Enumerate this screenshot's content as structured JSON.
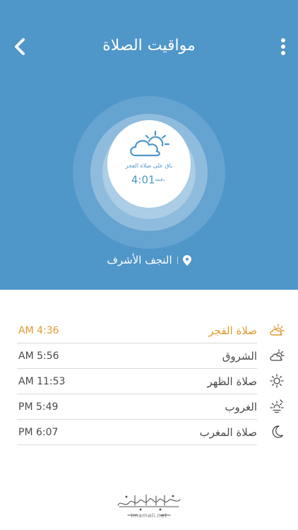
{
  "header": {
    "title": "مواقيت الصلاة"
  },
  "countdown": {
    "label": "باق على صلاة الفجر",
    "time": "4:01",
    "unit": "دقيقة"
  },
  "location": {
    "name": "النجف الأشرف"
  },
  "prayers": [
    {
      "name": "صلاة الفجر",
      "time": "AM 4:36",
      "icon": "sunrise-cloud-icon",
      "active": true
    },
    {
      "name": "الشروق",
      "time": "AM 5:56",
      "icon": "cloud-sun-icon",
      "active": false
    },
    {
      "name": "صلاة الظهر",
      "time": "AM 11:53",
      "icon": "sun-icon",
      "active": false
    },
    {
      "name": "الغروب",
      "time": "PM 5:49",
      "icon": "sunset-icon",
      "active": false
    },
    {
      "name": "صلاة المغرب",
      "time": "PM 6:07",
      "icon": "moon-icon",
      "active": false
    }
  ],
  "footer": {
    "url": "imamali.net"
  },
  "colors": {
    "primary": "#4f96c9",
    "active": "#e09a32",
    "text": "#4a4a4a"
  }
}
